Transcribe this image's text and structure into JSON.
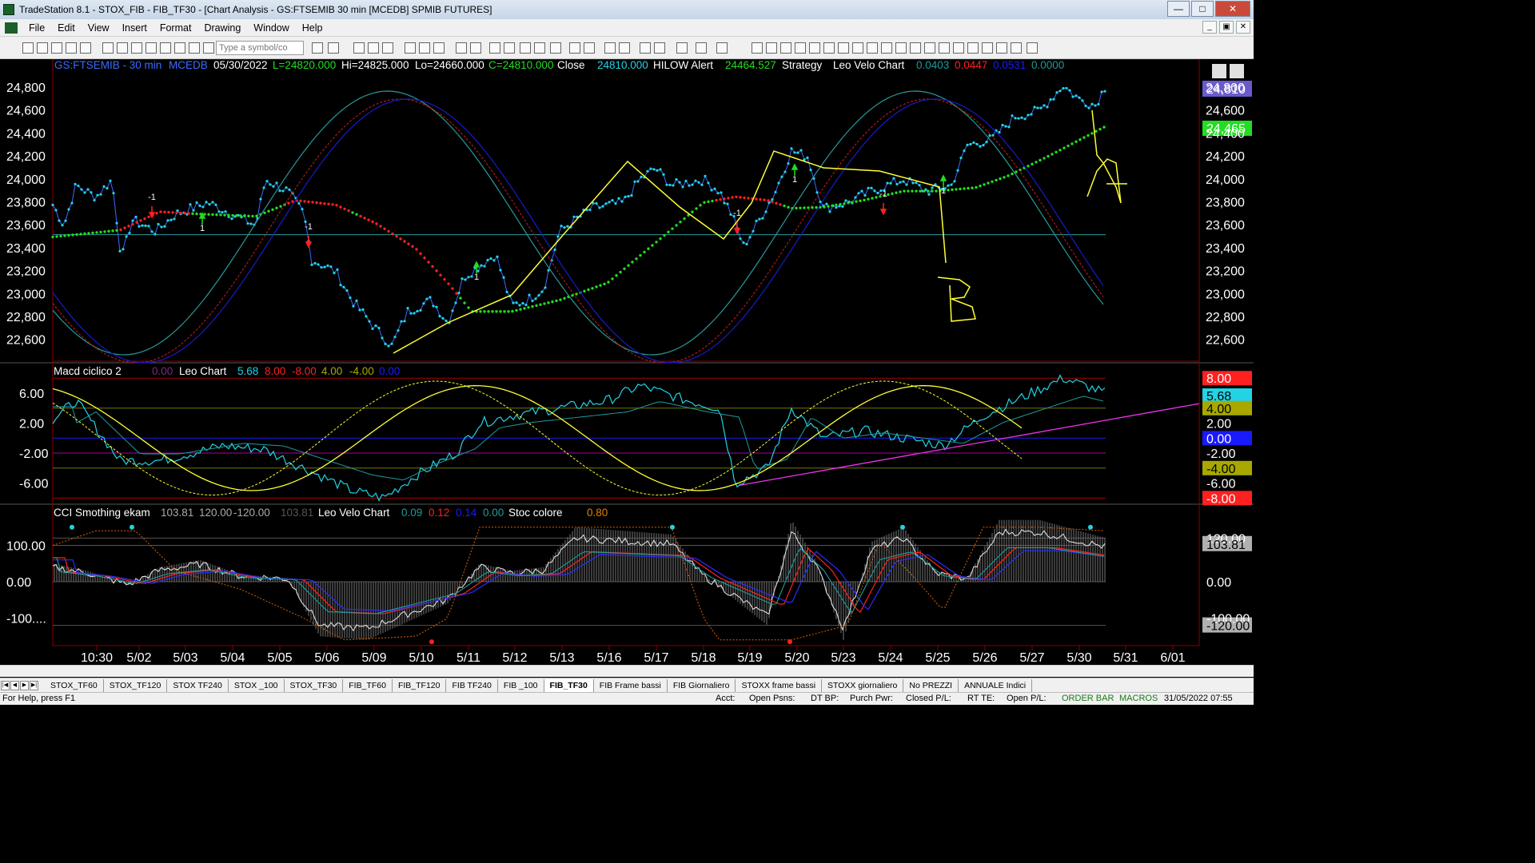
{
  "window": {
    "title": "TradeStation 8.1 - STOX_FIB - FIB_TF30 - [Chart Analysis - GS:FTSEMIB  30 min  [MCEDB] SPMIB FUTURES]"
  },
  "menu": [
    "File",
    "Edit",
    "View",
    "Insert",
    "Format",
    "Drawing",
    "Window",
    "Help"
  ],
  "toolbar": {
    "symbol_placeholder": "Type a symbol/co"
  },
  "price_header": {
    "symbol": "GS:FTSEMIB - 30 min",
    "source": "MCEDB",
    "date": "05/30/2022",
    "last": "L=24820.000",
    "high": "Hi=24825.000",
    "low": "Lo=24660.000",
    "close": "C=24810.000",
    "close_label": "Close",
    "close_value": "24810.000",
    "alert_label": "HILOW Alert",
    "alert_value": "24464.527",
    "strategy": "Strategy",
    "velo_label": "Leo Velo Chart",
    "v1": "0.0403",
    "v2": "0.0447",
    "v3": "0.0531",
    "v4": "0.0000"
  },
  "macd_header": {
    "name": "Macd ciclico 2",
    "v0": "0.00",
    "leo": "Leo Chart",
    "v1": "5.68",
    "v2": "8.00",
    "v3": "-8.00",
    "v4": "4.00",
    "v5": "-4.00",
    "v6": "0.00"
  },
  "cci_header": {
    "name": "CCI Smothing ekam",
    "v1": "103.81",
    "v2": "120.00",
    "v3": "-120.00",
    "v4": "103.81",
    "velo": "Leo Velo Chart",
    "w1": "0.09",
    "w2": "0.12",
    "w3": "0.14",
    "w4": "0.00",
    "stoc": "Stoc colore",
    "stoc_val": "0.80"
  },
  "price_axis": [
    "24,800",
    "24,600",
    "24,400",
    "24,200",
    "24,000",
    "23,800",
    "23,600",
    "23,400",
    "23,200",
    "23,000",
    "22,800",
    "22,600"
  ],
  "price_badges": {
    "last": "24,810",
    "alert": "24,465"
  },
  "macd_axis": [
    "6.00",
    "2.00",
    "-2.00",
    "-6.00"
  ],
  "macd_badges": [
    "8.00",
    "5.68",
    "4.00",
    "2.00",
    "0.00",
    "-2.00",
    "-4.00",
    "-6.00",
    "-8.00"
  ],
  "cci_axis": [
    "100.00",
    "0.00",
    "-100...."
  ],
  "cci_badges": [
    "120.00",
    "103.81",
    "0.00",
    "-100.00",
    "-120.00"
  ],
  "time_axis": [
    "10:30",
    "5/02",
    "5/03",
    "5/04",
    "5/05",
    "5/06",
    "5/09",
    "5/10",
    "5/11",
    "5/12",
    "5/13",
    "5/16",
    "5/17",
    "5/18",
    "5/19",
    "5/20",
    "5/23",
    "5/24",
    "5/25",
    "5/26",
    "5/27",
    "5/30",
    "5/31",
    "6/01"
  ],
  "markers": [
    "-1",
    "1",
    "-1",
    "1",
    "-1",
    "1",
    "-1",
    "1"
  ],
  "annotations": [
    "A",
    "B"
  ],
  "tabs": [
    "STOX_TF60",
    "STOX_TF120",
    "STOX TF240",
    "STOX _100",
    "STOX_TF30",
    "FIB_TF60",
    "FIB_TF120",
    "FIB TF240",
    "FIB _100",
    "FIB_TF30",
    "FIB Frame bassi",
    "FIB Giornaliero",
    "STOXX frame bassi",
    "STOXX giornaliero",
    "No PREZZI",
    "ANNUALE Indici"
  ],
  "active_tab": "FIB_TF30",
  "status": {
    "help": "For Help, press F1",
    "acct": "Acct:",
    "psns": "Open Psns:",
    "dtbp": "DT BP:",
    "pwr": "Purch Pwr:",
    "closed": "Closed P/L:",
    "rtte": "RT TE:",
    "open": "Open P/L:",
    "orderbar": "ORDER BAR",
    "macros": "MACROS",
    "datetime": "31/05/2022 07:55"
  },
  "colors": {
    "cyan": "#22d3e6",
    "yellow": "#ffff33",
    "red": "#ff2020",
    "green": "#22dd22",
    "blue": "#1a1aff",
    "magenta": "#ee33ee",
    "teal": "#1f9b9b"
  }
}
